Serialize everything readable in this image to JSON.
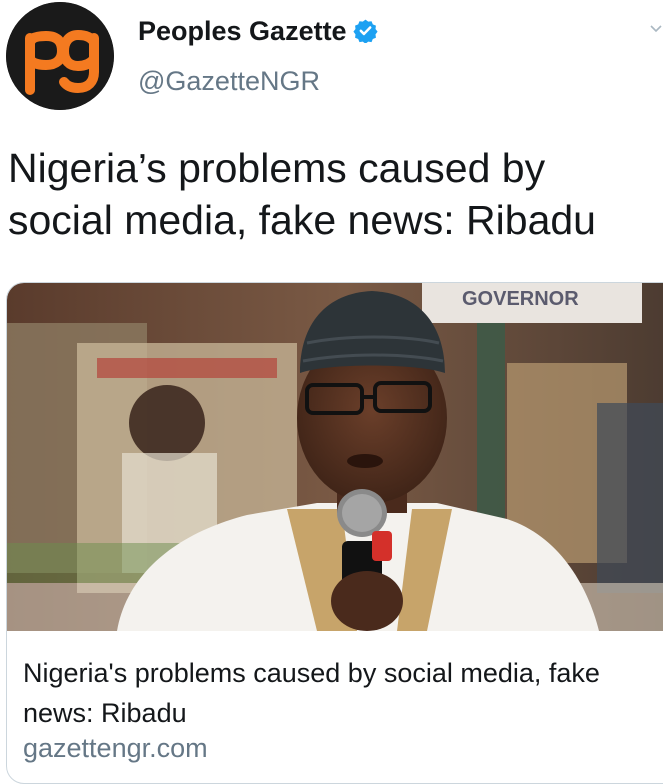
{
  "author": {
    "display_name": "Peoples Gazette",
    "handle": "@GazetteNGR",
    "avatar_logo_text": "pg",
    "verified": true
  },
  "tweet": {
    "text": "Nigeria’s problems caused by social media, fake news: Ribadu"
  },
  "card": {
    "title": "Nigeria's problems caused by social media, fake news: Ribadu",
    "domain": "gazettengr.com",
    "image_sign_text": "GOVERNOR"
  },
  "colors": {
    "brand_orange": "#f47a20",
    "verified_blue": "#1da1f2",
    "secondary_text": "#657786"
  },
  "icons": {
    "verified": "verified-badge-icon",
    "caret": "chevron-down-icon"
  }
}
